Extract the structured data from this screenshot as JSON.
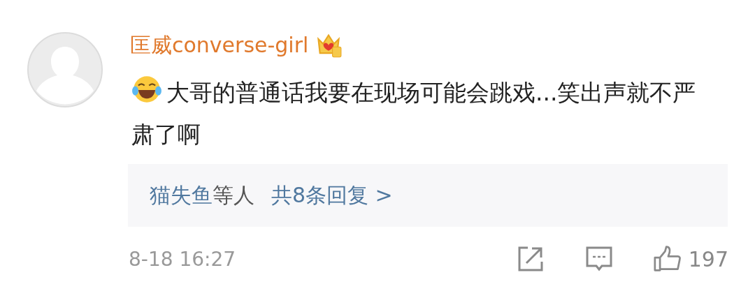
{
  "comment": {
    "user": "匡威converse-girl",
    "text": "大哥的普通话我要在现场可能会跳戏...笑出声就不严肃了啊",
    "replies": {
      "names": "猫失鱼",
      "suffix": "等人",
      "count": "共8条回复 >"
    },
    "time": "8-18 16:27",
    "likes": "197"
  }
}
